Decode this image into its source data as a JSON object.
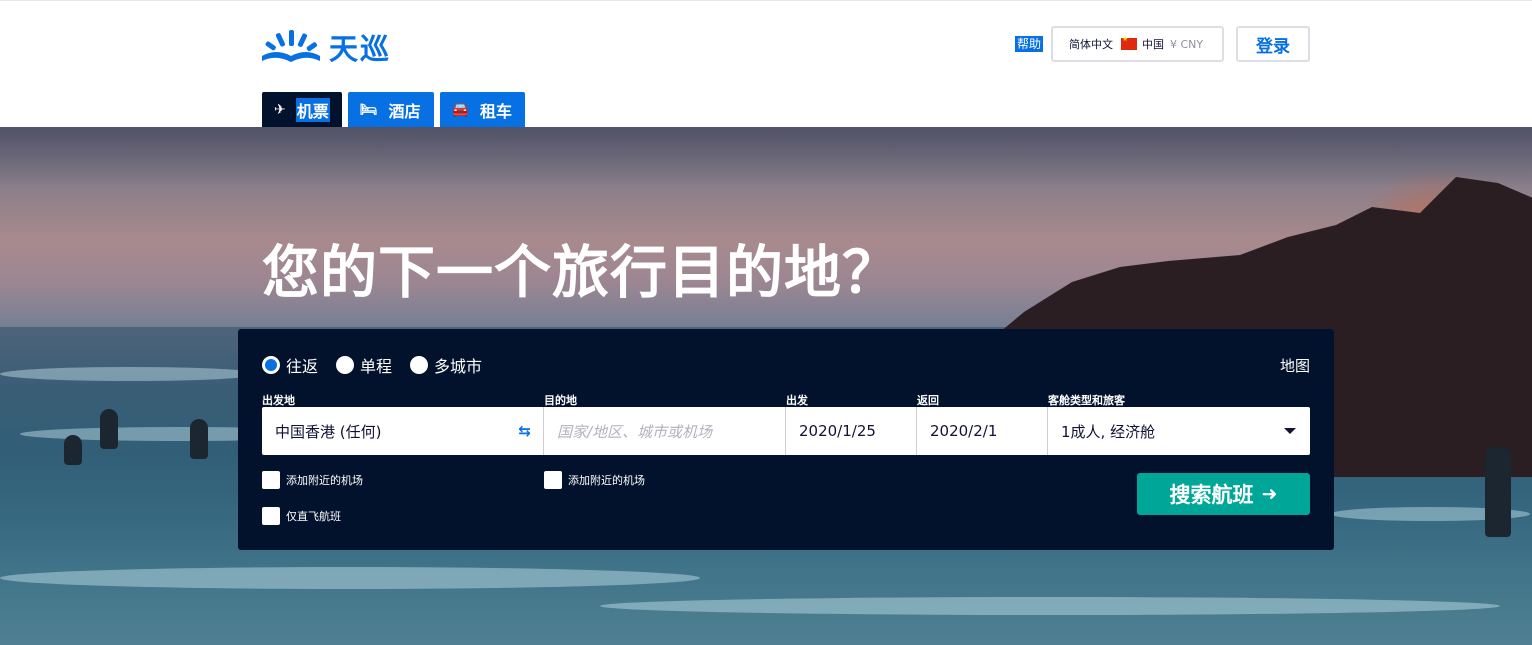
{
  "header": {
    "logo_text": "天巡",
    "help_label": "帮助",
    "locale": {
      "language": "简体中文",
      "country": "中国",
      "currency": "¥ CNY"
    },
    "login_label": "登录",
    "brand_color": "#0770e3"
  },
  "tabs": [
    {
      "icon": "airplane-icon",
      "glyph": "✈",
      "label": "机票",
      "active": true
    },
    {
      "icon": "bed-icon",
      "glyph": "🛏",
      "label": "酒店",
      "active": false
    },
    {
      "icon": "car-icon",
      "glyph": "🚘",
      "label": "租车",
      "active": false
    }
  ],
  "hero": {
    "title": "您的下一个旅行目的地？"
  },
  "search": {
    "trip_types": [
      {
        "label": "往返",
        "selected": true
      },
      {
        "label": "单程",
        "selected": false
      },
      {
        "label": "多城市",
        "selected": false
      }
    ],
    "map_label": "地图",
    "labels": {
      "origin": "出发地",
      "destination": "目的地",
      "depart": "出发",
      "return": "返回",
      "cabin": "客舱类型和旅客"
    },
    "origin_value": "中国香港 (任何)",
    "destination_placeholder": "国家/地区、城市或机场",
    "depart_value": "2020/1/25",
    "return_value": "2020/2/1",
    "cabin_value": "1成人, 经济舱",
    "add_nearby_origin": "添加附近的机场",
    "add_nearby_destination": "添加附近的机场",
    "direct_only": "仅直飞航班",
    "search_button": "搜索航班",
    "search_color": "#00a698"
  }
}
